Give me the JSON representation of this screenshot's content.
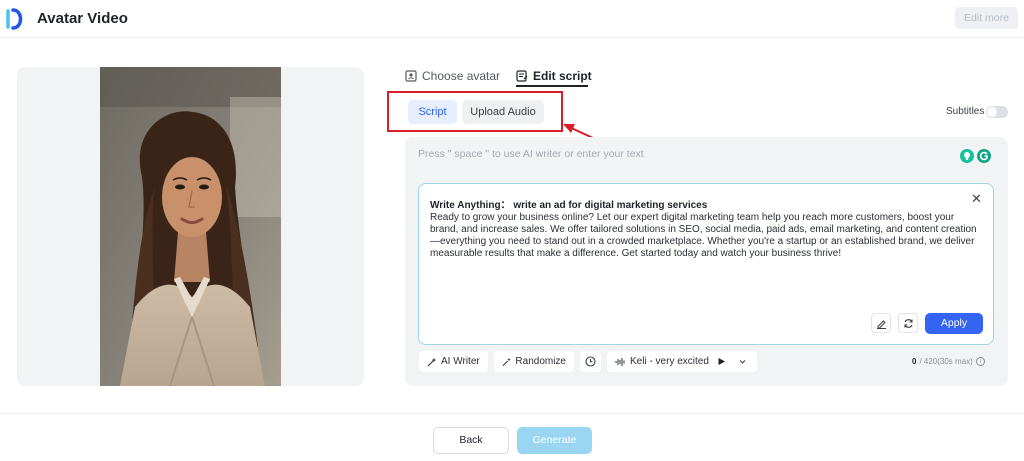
{
  "header": {
    "title": "Avatar Video",
    "edit_more_label": "Edit more"
  },
  "tabs": [
    {
      "label": "Choose avatar",
      "active": false
    },
    {
      "label": "Edit script",
      "active": true
    }
  ],
  "mode_buttons": {
    "script_label": "Script",
    "upload_audio_label": "Upload Audio"
  },
  "subtitles": {
    "label": "Subtitles",
    "enabled": false
  },
  "editor": {
    "placeholder": "Press \" space \" to use AI writer or enter your text"
  },
  "ai_writer_card": {
    "title": "Write Anything： write an ad for digital marketing services",
    "body": "Ready to grow your business online? Let our expert digital marketing team help you reach more customers, boost your brand, and increase sales. We offer tailored solutions in SEO, social media, paid ads, email marketing, and content creation—everything you need to stand out in a crowded marketplace. Whether you're a startup or an established brand, we deliver measurable results that make a difference. Get started today and watch your business thrive!",
    "apply_label": "Apply"
  },
  "toolbar": {
    "ai_writer_label": "AI Writer",
    "randomize_label": "Randomize",
    "voice_label": "Keli - very excited",
    "char_count": "0",
    "char_limit": "/ 420(30s max)"
  },
  "footer": {
    "back_label": "Back",
    "generate_label": "Generate"
  },
  "colors": {
    "accent": "#3563f2",
    "highlight": "#d81e26",
    "generate_disabled": "#9ad6f2"
  }
}
